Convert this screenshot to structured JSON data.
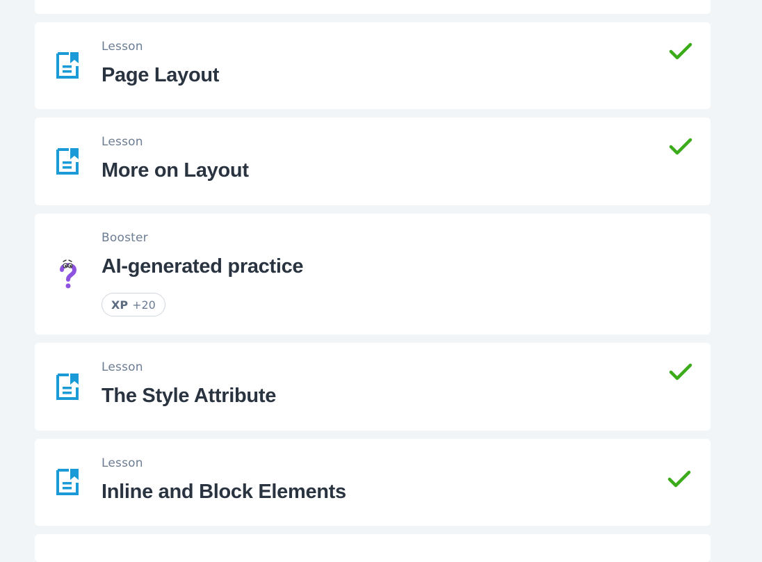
{
  "colors": {
    "accent_blue": "#1a9ad6",
    "check_green": "#3bab1a",
    "booster_purple": "#8e52e0"
  },
  "items": [
    {
      "kind": "Lesson",
      "title": "Page Layout",
      "icon": "lesson-document-icon",
      "completed": true
    },
    {
      "kind": "Lesson",
      "title": "More on Layout",
      "icon": "lesson-document-icon",
      "completed": true
    },
    {
      "kind": "Booster",
      "title": "AI-generated practice",
      "icon": "question-mark-character-icon",
      "completed": false,
      "xp": {
        "label": "XP",
        "value": "+20"
      }
    },
    {
      "kind": "Lesson",
      "title": "The Style Attribute",
      "icon": "lesson-document-icon",
      "completed": true
    },
    {
      "kind": "Lesson",
      "title": "Inline and Block Elements",
      "icon": "lesson-document-icon",
      "completed": true
    }
  ]
}
